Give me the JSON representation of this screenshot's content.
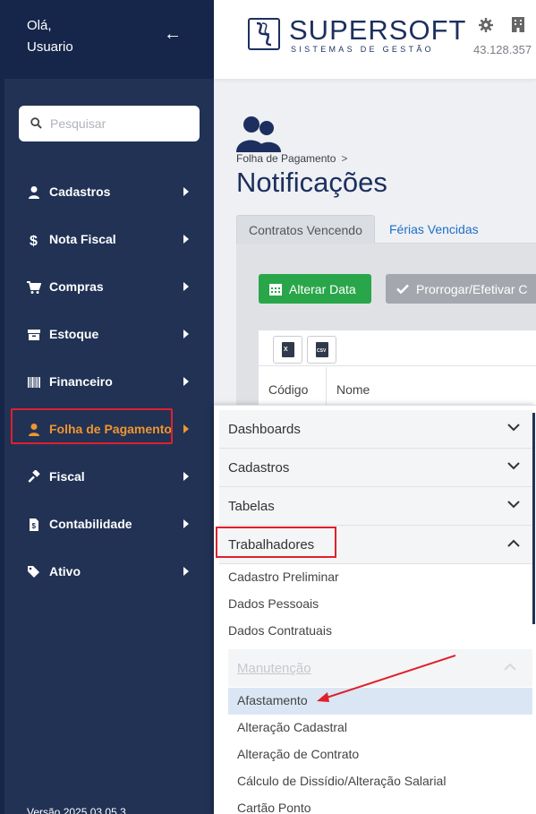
{
  "sidebar": {
    "greeting": "Olá,",
    "user": "Usuario",
    "back": "←",
    "search_placeholder": "Pesquisar",
    "items": [
      {
        "label": "Cadastros",
        "icon": "user-icon"
      },
      {
        "label": "Nota Fiscal",
        "icon": "dollar-icon"
      },
      {
        "label": "Compras",
        "icon": "cart-icon"
      },
      {
        "label": "Estoque",
        "icon": "archive-box-icon"
      },
      {
        "label": "Financeiro",
        "icon": "barcode-icon"
      },
      {
        "label": "Folha de Pagamento",
        "icon": "user-icon",
        "active": true
      },
      {
        "label": "Fiscal",
        "icon": "gavel-icon"
      },
      {
        "label": "Contabilidade",
        "icon": "invoice-icon"
      },
      {
        "label": "Ativo",
        "icon": "tags-icon"
      }
    ],
    "version": "Versão 2025.03.05.3"
  },
  "header": {
    "brand": "SUPERSOFT",
    "tagline": "SISTEMAS DE GESTÃO",
    "cnpj": "43.128.357"
  },
  "main": {
    "breadcrumb": "Folha de Pagamento",
    "breadcrumb_sep": ">",
    "title": "Notificações",
    "tabs": [
      {
        "label": "Contratos Vencendo",
        "active": true
      },
      {
        "label": "Férias Vencidas",
        "active": false
      }
    ],
    "buttons": {
      "alter_date": "Alterar Data",
      "extend": "Prorrogar/Efetivar C"
    },
    "export": {
      "excel": "X",
      "csv": "CSV"
    },
    "table_headers": [
      "Código",
      "Nome"
    ]
  },
  "menu": {
    "sections": [
      {
        "label": "Dashboards",
        "expanded": false
      },
      {
        "label": "Cadastros",
        "expanded": false
      },
      {
        "label": "Tabelas",
        "expanded": false
      },
      {
        "label": "Trabalhadores",
        "expanded": true
      }
    ],
    "trabalhadores_items": [
      "Cadastro Preliminar",
      "Dados Pessoais",
      "Dados Contratuais"
    ],
    "submenu": {
      "label": "Manutenção",
      "items": [
        "Afastamento",
        "Alteração Cadastral",
        "Alteração de Contrato",
        "Cálculo de Dissídio/Alteração Salarial",
        "Cartão Ponto"
      ],
      "selected": "Afastamento"
    }
  },
  "colors": {
    "sidebar": "#213255",
    "sidebar_dark": "#16264a",
    "accent_orange": "#f0952f",
    "highlight_red": "#e0202a",
    "green_button": "#2aa64a",
    "brand_navy": "#1c2f5f",
    "link_blue": "#1e6fc7"
  }
}
